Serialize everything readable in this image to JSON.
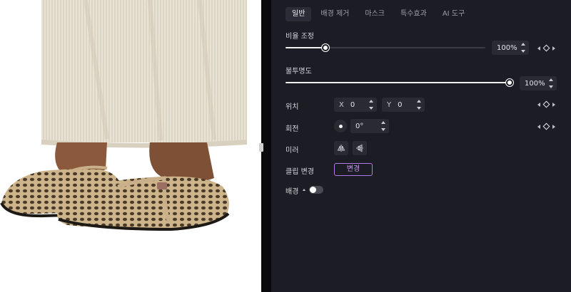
{
  "tabs": [
    {
      "label": "일반",
      "active": true
    },
    {
      "label": "배경 제거",
      "active": false
    },
    {
      "label": "마스크",
      "active": false
    },
    {
      "label": "특수효과",
      "active": false
    },
    {
      "label": "AI 도구",
      "active": false
    }
  ],
  "scale": {
    "label": "비율 조정",
    "value": "100%",
    "slider_fraction": 0.2
  },
  "opacity": {
    "label": "불투명도",
    "value": "100%",
    "slider_fraction": 1.0
  },
  "position": {
    "label": "위치",
    "x_prefix": "X",
    "x_value": "0",
    "y_prefix": "Y",
    "y_value": "0"
  },
  "rotation": {
    "label": "회전",
    "value": "0°"
  },
  "mirror": {
    "label": "미러"
  },
  "clip": {
    "label": "클립 변경",
    "button_label": "변경"
  },
  "background": {
    "label": "배경",
    "enabled": false
  },
  "colors": {
    "panel_bg": "#1c1c24",
    "accent_purple": "#b07be8",
    "field_bg": "#2a2a33"
  }
}
